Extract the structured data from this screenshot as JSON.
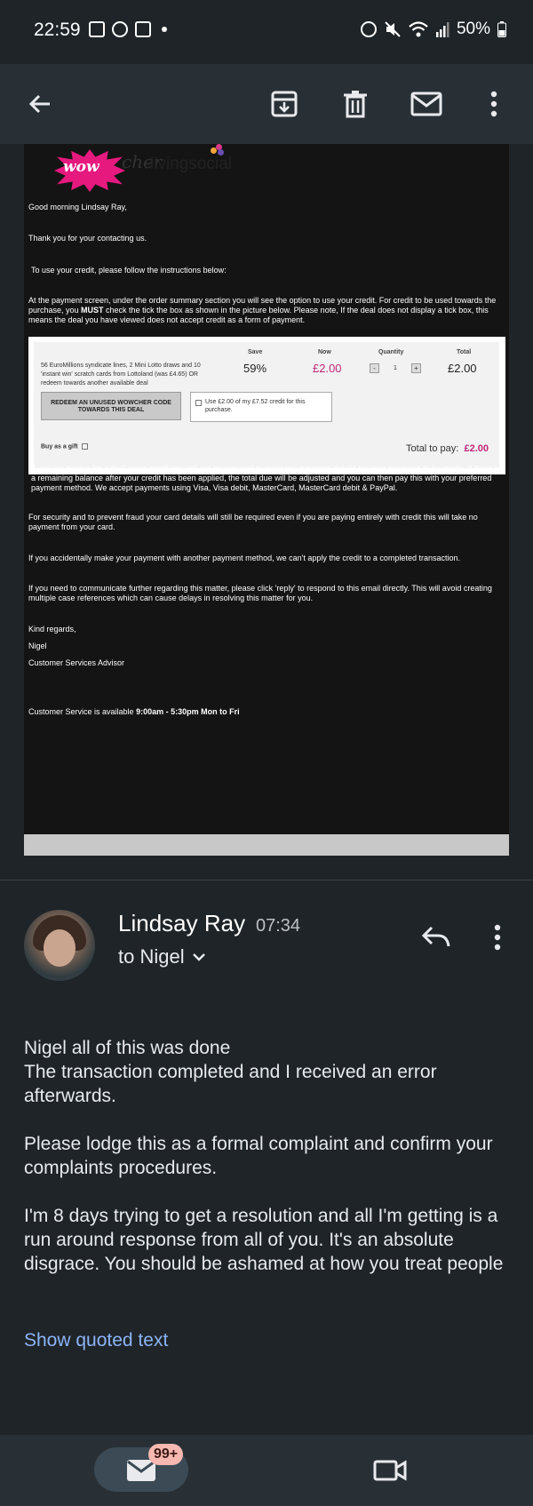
{
  "status_bar": {
    "time": "22:59",
    "battery": "50%",
    "icons": [
      "gallery-icon",
      "facebook-icon",
      "instagram-icon",
      "alarm-icon",
      "mute-icon",
      "wifi-icon",
      "signal-icon",
      "battery-icon"
    ]
  },
  "toolbar": {
    "back": "arrow-back-icon",
    "archive": "archive-icon",
    "delete": "trash-icon",
    "mark_unread": "mail-icon",
    "more": "more-vert-icon"
  },
  "quoted_email": {
    "logo_wow": "wow",
    "logo_tail": "cher",
    "logo_partner": "livingsocial",
    "greeting": "Good morning Lindsay Ray,",
    "p1": "Thank you for your contacting us.",
    "p2": "To use your credit, please follow the instructions below:",
    "p3a": "At the payment screen, under the order summary section you will see the option to use your credit. For credit to be used towards the purchase, you ",
    "p3b": "MUST",
    "p3c": " check the tick the box as shown in the picture below. Please note, If the deal does not display a tick box, this means the deal you have viewed does not accept credit as a form of payment.",
    "order": {
      "header_save": "Save",
      "header_now": "Now",
      "header_qty": "Quantity",
      "header_total": "Total",
      "deal": "56 EuroMillions syndicate lines, 2 Mini Lotto draws and 10 'instant win' scratch cards from Lottoland (was £4.65) OR redeem towards another available deal",
      "save": "59%",
      "now": "£2.00",
      "qty_minus": "-",
      "qty": "1",
      "qty_plus": "+",
      "total": "£2.00",
      "redeem_btn": "REDEEM AN UNUSED WOWCHER CODE TOWARDS THIS DEAL",
      "credit_label": "Use £2.00 of my £7.52 credit for this purchase.",
      "gift": "Buy as a gift",
      "to_pay_label": "Total to pay:",
      "to_pay_value": "£2.00"
    },
    "p4": "If you are paying for a deal using credit you will still be required to enter you payment details for your purchase to be made. If there is a remaining balance after your credit has been applied, the total due will be adjusted and you can then pay this with your preferred payment method. We accept payments using Visa, Visa debit, MasterCard, MasterCard debit & PayPal.",
    "p5": "For security and to prevent fraud your card details will still be required even if you are paying entirely with credit this will take no payment from your card.",
    "p6": "If you accidentally make your payment with another payment method, we can't apply the credit to a completed transaction.",
    "p7": "If you need to communicate further regarding this matter, please click 'reply' to respond to this email directly. This will avoid creating multiple case references which can cause delays in resolving this matter for you.",
    "signoff": "Kind regards,",
    "signer": "Nigel",
    "signer_role": "Customer Services Advisor",
    "hours_a": "Customer Service is available ",
    "hours_b": "9:00am - 5:30pm Mon to Fri"
  },
  "message": {
    "sender": "Lindsay Ray",
    "time": "07:34",
    "to": "to Nigel",
    "line1": "Nigel all of this was done",
    "line2": "The transaction completed and I received an error afterwards.",
    "para2": "Please lodge this as a formal complaint and confirm your complaints procedures.",
    "para3": "I'm 8 days trying to get a resolution and all I'm getting is a run around response from all of you. It's an absolute disgrace. You should be ashamed at how you treat people",
    "show_quoted": "Show quoted text"
  },
  "bottom_nav": {
    "badge": "99+",
    "mail": "mail-icon",
    "meet": "video-icon"
  }
}
